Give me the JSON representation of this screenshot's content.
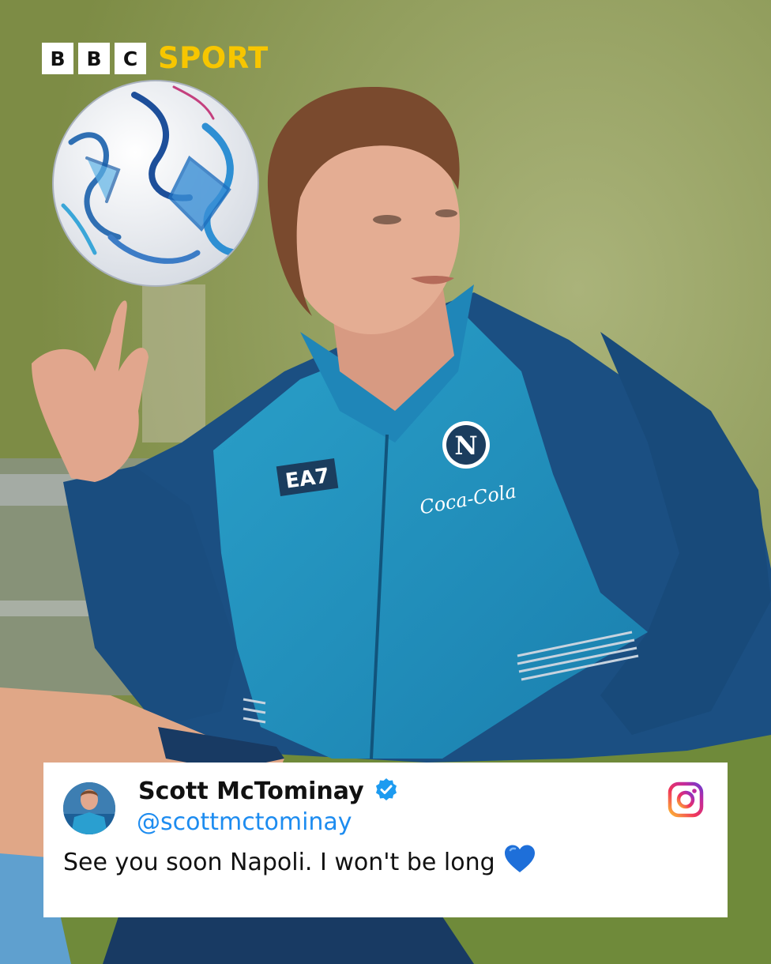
{
  "brand": {
    "letters": [
      "B",
      "B",
      "C"
    ],
    "word": "SPORT",
    "accent": "#f7c600"
  },
  "post": {
    "author_name": "Scott McTominay",
    "handle": "@scottmctominay",
    "text": "See you soon Napoli. I won't be long",
    "verified": true,
    "heart_color": "#1e6fd9",
    "platform_icon": "instagram-icon"
  },
  "photo": {
    "subject": "footballer-spinning-ball",
    "kit_sponsor": "EA7",
    "shirt_sponsor": "Coca-Cola",
    "crest_letter": "N"
  }
}
